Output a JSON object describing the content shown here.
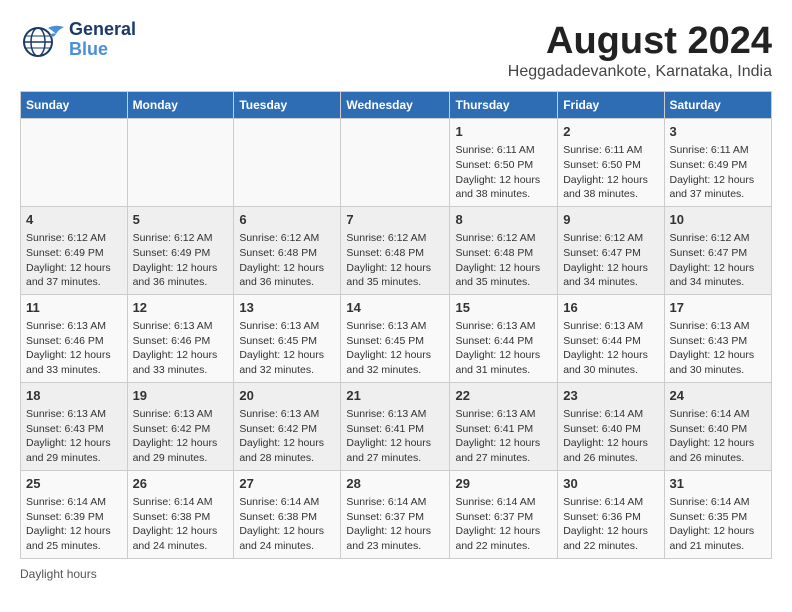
{
  "header": {
    "logo_line1": "General",
    "logo_line2": "Blue",
    "title": "August 2024",
    "subtitle": "Heggadadevankote, Karnataka, India"
  },
  "calendar": {
    "days_of_week": [
      "Sunday",
      "Monday",
      "Tuesday",
      "Wednesday",
      "Thursday",
      "Friday",
      "Saturday"
    ],
    "weeks": [
      [
        {
          "day": "",
          "info": ""
        },
        {
          "day": "",
          "info": ""
        },
        {
          "day": "",
          "info": ""
        },
        {
          "day": "",
          "info": ""
        },
        {
          "day": "1",
          "info": "Sunrise: 6:11 AM\nSunset: 6:50 PM\nDaylight: 12 hours\nand 38 minutes."
        },
        {
          "day": "2",
          "info": "Sunrise: 6:11 AM\nSunset: 6:50 PM\nDaylight: 12 hours\nand 38 minutes."
        },
        {
          "day": "3",
          "info": "Sunrise: 6:11 AM\nSunset: 6:49 PM\nDaylight: 12 hours\nand 37 minutes."
        }
      ],
      [
        {
          "day": "4",
          "info": "Sunrise: 6:12 AM\nSunset: 6:49 PM\nDaylight: 12 hours\nand 37 minutes."
        },
        {
          "day": "5",
          "info": "Sunrise: 6:12 AM\nSunset: 6:49 PM\nDaylight: 12 hours\nand 36 minutes."
        },
        {
          "day": "6",
          "info": "Sunrise: 6:12 AM\nSunset: 6:48 PM\nDaylight: 12 hours\nand 36 minutes."
        },
        {
          "day": "7",
          "info": "Sunrise: 6:12 AM\nSunset: 6:48 PM\nDaylight: 12 hours\nand 35 minutes."
        },
        {
          "day": "8",
          "info": "Sunrise: 6:12 AM\nSunset: 6:48 PM\nDaylight: 12 hours\nand 35 minutes."
        },
        {
          "day": "9",
          "info": "Sunrise: 6:12 AM\nSunset: 6:47 PM\nDaylight: 12 hours\nand 34 minutes."
        },
        {
          "day": "10",
          "info": "Sunrise: 6:12 AM\nSunset: 6:47 PM\nDaylight: 12 hours\nand 34 minutes."
        }
      ],
      [
        {
          "day": "11",
          "info": "Sunrise: 6:13 AM\nSunset: 6:46 PM\nDaylight: 12 hours\nand 33 minutes."
        },
        {
          "day": "12",
          "info": "Sunrise: 6:13 AM\nSunset: 6:46 PM\nDaylight: 12 hours\nand 33 minutes."
        },
        {
          "day": "13",
          "info": "Sunrise: 6:13 AM\nSunset: 6:45 PM\nDaylight: 12 hours\nand 32 minutes."
        },
        {
          "day": "14",
          "info": "Sunrise: 6:13 AM\nSunset: 6:45 PM\nDaylight: 12 hours\nand 32 minutes."
        },
        {
          "day": "15",
          "info": "Sunrise: 6:13 AM\nSunset: 6:44 PM\nDaylight: 12 hours\nand 31 minutes."
        },
        {
          "day": "16",
          "info": "Sunrise: 6:13 AM\nSunset: 6:44 PM\nDaylight: 12 hours\nand 30 minutes."
        },
        {
          "day": "17",
          "info": "Sunrise: 6:13 AM\nSunset: 6:43 PM\nDaylight: 12 hours\nand 30 minutes."
        }
      ],
      [
        {
          "day": "18",
          "info": "Sunrise: 6:13 AM\nSunset: 6:43 PM\nDaylight: 12 hours\nand 29 minutes."
        },
        {
          "day": "19",
          "info": "Sunrise: 6:13 AM\nSunset: 6:42 PM\nDaylight: 12 hours\nand 29 minutes."
        },
        {
          "day": "20",
          "info": "Sunrise: 6:13 AM\nSunset: 6:42 PM\nDaylight: 12 hours\nand 28 minutes."
        },
        {
          "day": "21",
          "info": "Sunrise: 6:13 AM\nSunset: 6:41 PM\nDaylight: 12 hours\nand 27 minutes."
        },
        {
          "day": "22",
          "info": "Sunrise: 6:13 AM\nSunset: 6:41 PM\nDaylight: 12 hours\nand 27 minutes."
        },
        {
          "day": "23",
          "info": "Sunrise: 6:14 AM\nSunset: 6:40 PM\nDaylight: 12 hours\nand 26 minutes."
        },
        {
          "day": "24",
          "info": "Sunrise: 6:14 AM\nSunset: 6:40 PM\nDaylight: 12 hours\nand 26 minutes."
        }
      ],
      [
        {
          "day": "25",
          "info": "Sunrise: 6:14 AM\nSunset: 6:39 PM\nDaylight: 12 hours\nand 25 minutes."
        },
        {
          "day": "26",
          "info": "Sunrise: 6:14 AM\nSunset: 6:38 PM\nDaylight: 12 hours\nand 24 minutes."
        },
        {
          "day": "27",
          "info": "Sunrise: 6:14 AM\nSunset: 6:38 PM\nDaylight: 12 hours\nand 24 minutes."
        },
        {
          "day": "28",
          "info": "Sunrise: 6:14 AM\nSunset: 6:37 PM\nDaylight: 12 hours\nand 23 minutes."
        },
        {
          "day": "29",
          "info": "Sunrise: 6:14 AM\nSunset: 6:37 PM\nDaylight: 12 hours\nand 22 minutes."
        },
        {
          "day": "30",
          "info": "Sunrise: 6:14 AM\nSunset: 6:36 PM\nDaylight: 12 hours\nand 22 minutes."
        },
        {
          "day": "31",
          "info": "Sunrise: 6:14 AM\nSunset: 6:35 PM\nDaylight: 12 hours\nand 21 minutes."
        }
      ]
    ],
    "footer": "Daylight hours"
  }
}
